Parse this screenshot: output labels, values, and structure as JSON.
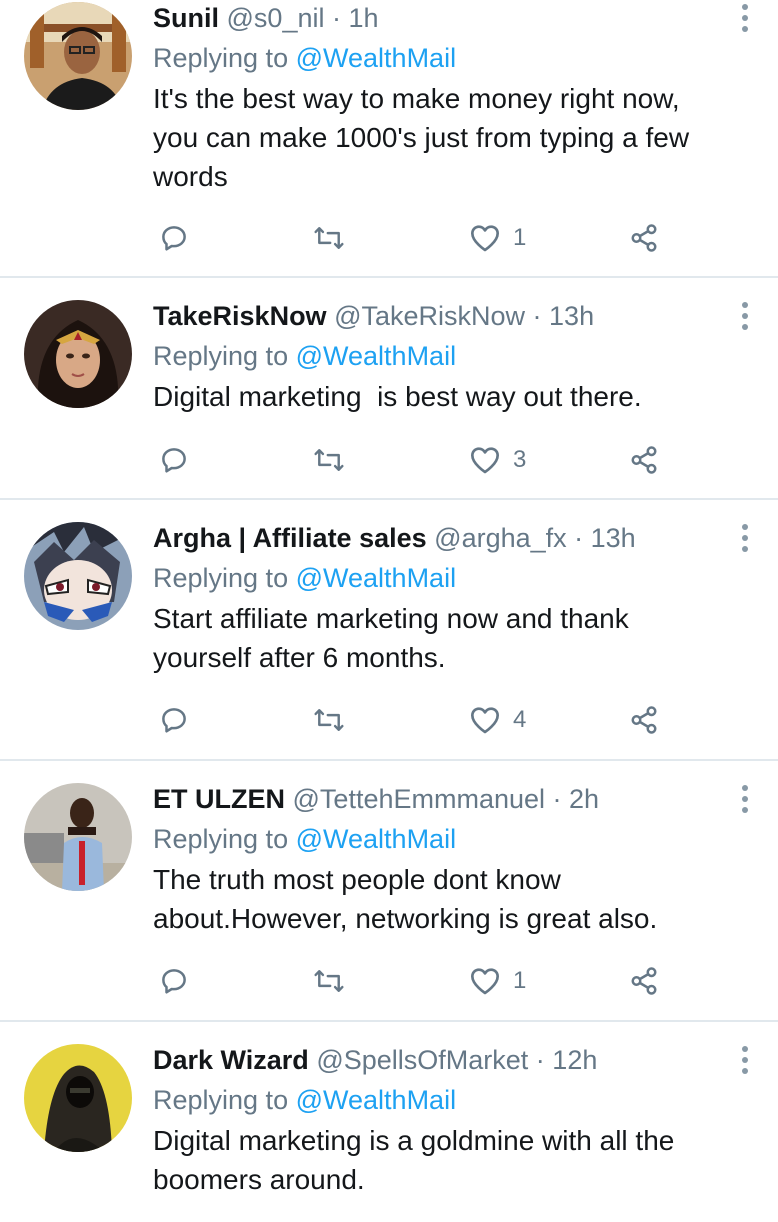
{
  "replying_label": "Replying to",
  "tweets": [
    {
      "name": "Sunil",
      "handle": "@s0_nil",
      "time": "1h",
      "reply_to": "@WealthMail",
      "text_lines": [
        "It's the best way to make money right now,",
        "you can make 1000's just from typing a few",
        "words"
      ],
      "likes": "1",
      "avatar_icon": "avatar-photo"
    },
    {
      "name": "TakeRiskNow",
      "handle": "@TakeRiskNow",
      "time": "13h",
      "reply_to": "@WealthMail",
      "text_lines": [
        "Digital marketing  is best way out there."
      ],
      "likes": "3",
      "avatar_icon": "avatar-photo"
    },
    {
      "name": "Argha | Affiliate sales",
      "handle": "@argha_fx",
      "time": "13h",
      "reply_to": "@WealthMail",
      "text_lines": [
        "Start affiliate marketing now and thank",
        "yourself after 6 months."
      ],
      "likes": "4",
      "avatar_icon": "avatar-photo"
    },
    {
      "name": "ET ULZEN",
      "handle": "@TettehEmmmanuel",
      "time": "2h",
      "reply_to": "@WealthMail",
      "text_lines": [
        "The truth most people dont know",
        "about.However, networking is great also."
      ],
      "likes": "1",
      "avatar_icon": "avatar-photo"
    },
    {
      "name": "Dark Wizard",
      "handle": "@SpellsOfMarket",
      "time": "12h",
      "reply_to": "@WealthMail",
      "text_lines": [
        "Digital marketing is a goldmine with all the",
        "boomers around."
      ],
      "likes": "",
      "avatar_icon": "avatar-photo"
    }
  ],
  "icons": {
    "reply": "reply-icon",
    "retweet": "retweet-icon",
    "like": "heart-icon",
    "share": "share-icon",
    "more": "more-vertical-icon"
  },
  "colors": {
    "link": "#1da1f2",
    "secondary_text": "#657786",
    "primary_text": "#14171a",
    "divider": "#e1e8ed"
  }
}
